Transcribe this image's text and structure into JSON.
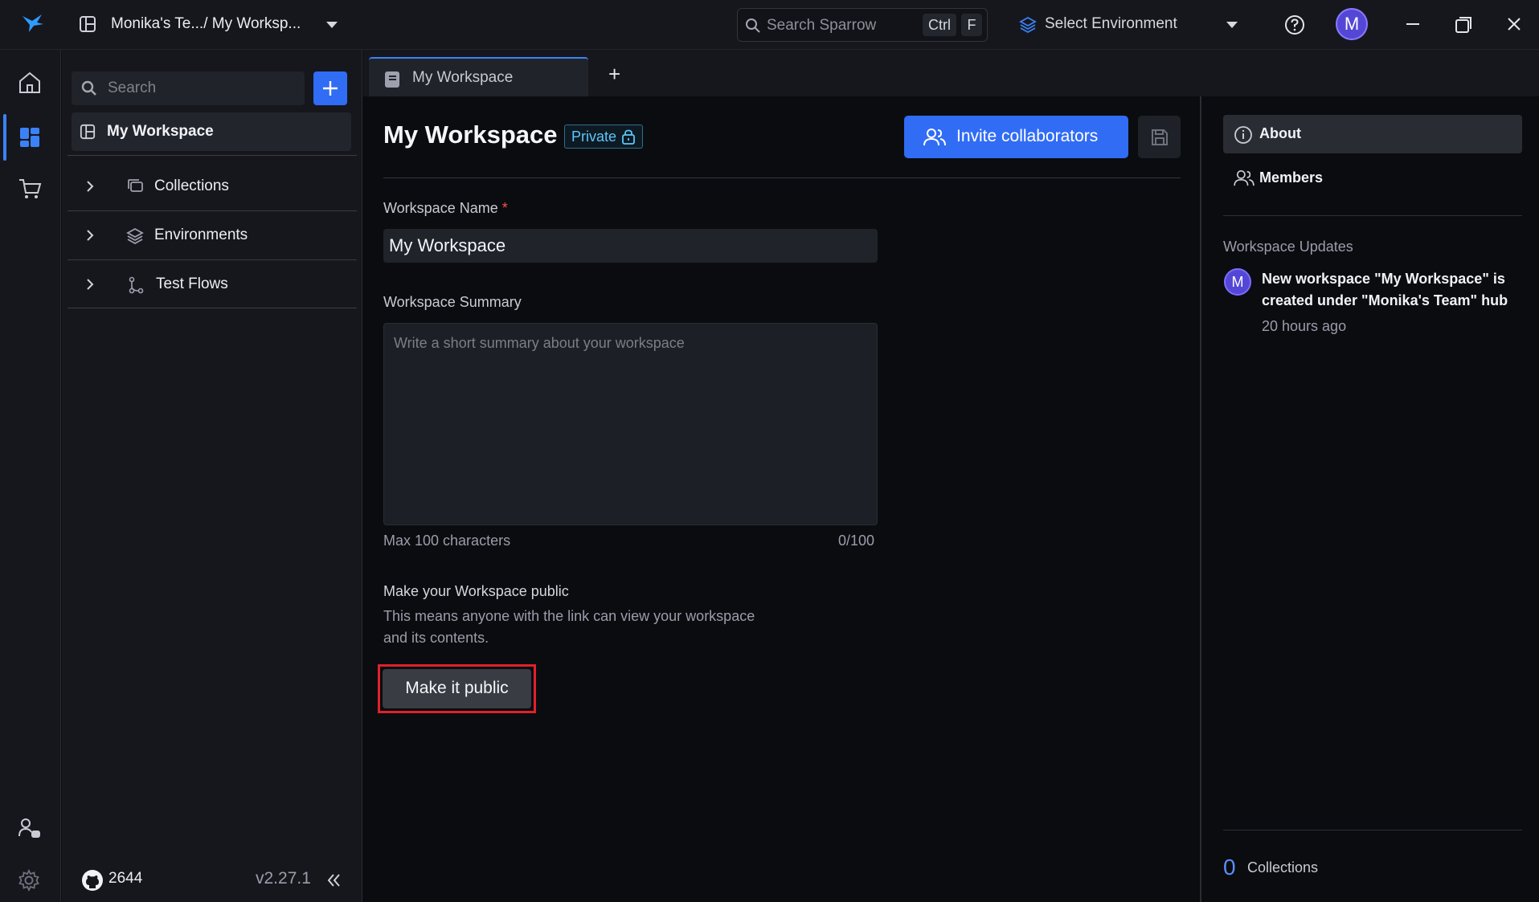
{
  "topbar": {
    "workspace_path": "Monika's Te.../ My Worksp...",
    "search_placeholder": "Search Sparrow",
    "shortcut_ctrl": "Ctrl",
    "shortcut_key": "F",
    "environment_label": "Select Environment",
    "avatar_initial": "M"
  },
  "sidebar": {
    "search_placeholder": "Search",
    "workspace_label": "My Workspace",
    "items": [
      {
        "label": "Collections",
        "icon": "collections-icon"
      },
      {
        "label": "Environments",
        "icon": "environments-icon"
      },
      {
        "label": "Test Flows",
        "icon": "test-flows-icon"
      }
    ],
    "github_stars": "2644",
    "version": "v2.27.1"
  },
  "tabs": [
    {
      "label": "My Workspace",
      "active": true
    }
  ],
  "tab_add_label": "+",
  "main": {
    "title": "My Workspace",
    "visibility_badge": "Private",
    "invite_button": "Invite collaborators",
    "name_label": "Workspace Name",
    "required_mark": "*",
    "name_value": "My Workspace",
    "summary_label": "Workspace Summary",
    "summary_placeholder": "Write a short summary about your workspace",
    "summary_value": "",
    "max_chars_hint": "Max 100 characters",
    "char_count": "0/100",
    "public_title": "Make your Workspace public",
    "public_desc_line1": "This means anyone with the link can view your workspace",
    "public_desc_line2": "and its contents.",
    "public_button": "Make it public"
  },
  "right_panel": {
    "about_label": "About",
    "members_label": "Members",
    "updates_heading": "Workspace Updates",
    "update_avatar": "M",
    "update_text": "New workspace \"My Workspace\" is created under \"Monika's Team\" hub",
    "update_time": "20 hours ago",
    "collections_count": "0",
    "collections_label": "Collections"
  },
  "colors": {
    "accent": "#316cf4",
    "badge_text": "#5cc5ff",
    "highlight_outline": "#e0212b",
    "avatar": "#5447d6"
  }
}
